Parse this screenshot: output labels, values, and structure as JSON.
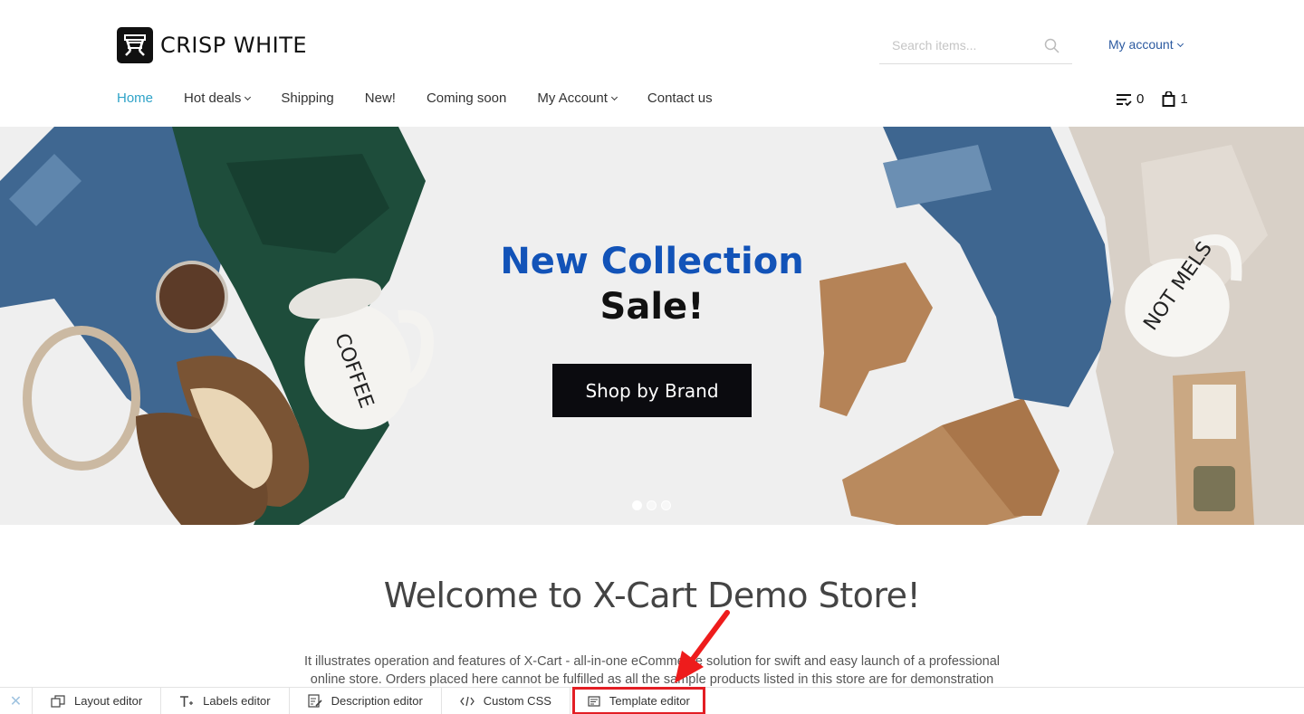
{
  "store": {
    "name": "CRISP WHITE"
  },
  "search": {
    "placeholder": "Search items..."
  },
  "account": {
    "label": "My account"
  },
  "nav": {
    "items": [
      {
        "label": "Home",
        "active": true,
        "dropdown": false
      },
      {
        "label": "Hot deals",
        "active": false,
        "dropdown": true
      },
      {
        "label": "Shipping",
        "active": false,
        "dropdown": false
      },
      {
        "label": "New!",
        "active": false,
        "dropdown": false
      },
      {
        "label": "Coming soon",
        "active": false,
        "dropdown": false
      },
      {
        "label": "My Account",
        "active": false,
        "dropdown": true
      },
      {
        "label": "Contact us",
        "active": false,
        "dropdown": false
      }
    ]
  },
  "header_icons": {
    "compare_count": "0",
    "cart_count": "1"
  },
  "banner": {
    "title": "New Collection",
    "subtitle": "Sale!",
    "button": "Shop by Brand",
    "mug_left_text": "COFFEE",
    "mug_right_text": "NOT MELS",
    "slides_total": 3,
    "active_slide": 1
  },
  "welcome": {
    "title": "Welcome to X-Cart Demo Store!",
    "text": "It illustrates operation and features of X-Cart - all-in-one eCommerce solution for swift and easy launch of a professional online store. Orders placed here cannot be fulfilled as all the sample products listed in this store are for demonstration"
  },
  "toolbar": {
    "close_icon": "close-icon",
    "items": [
      {
        "label": "Layout editor",
        "icon": "layout-icon"
      },
      {
        "label": "Labels editor",
        "icon": "text-icon"
      },
      {
        "label": "Description editor",
        "icon": "edit-doc-icon"
      },
      {
        "label": "Custom CSS",
        "icon": "code-icon"
      },
      {
        "label": "Template editor",
        "icon": "template-icon",
        "highlighted": true
      }
    ]
  },
  "colors": {
    "accent": "#2fa3c8",
    "link": "#2c5aa0",
    "banner_title": "#1253b8",
    "highlight": "#e31e24"
  }
}
